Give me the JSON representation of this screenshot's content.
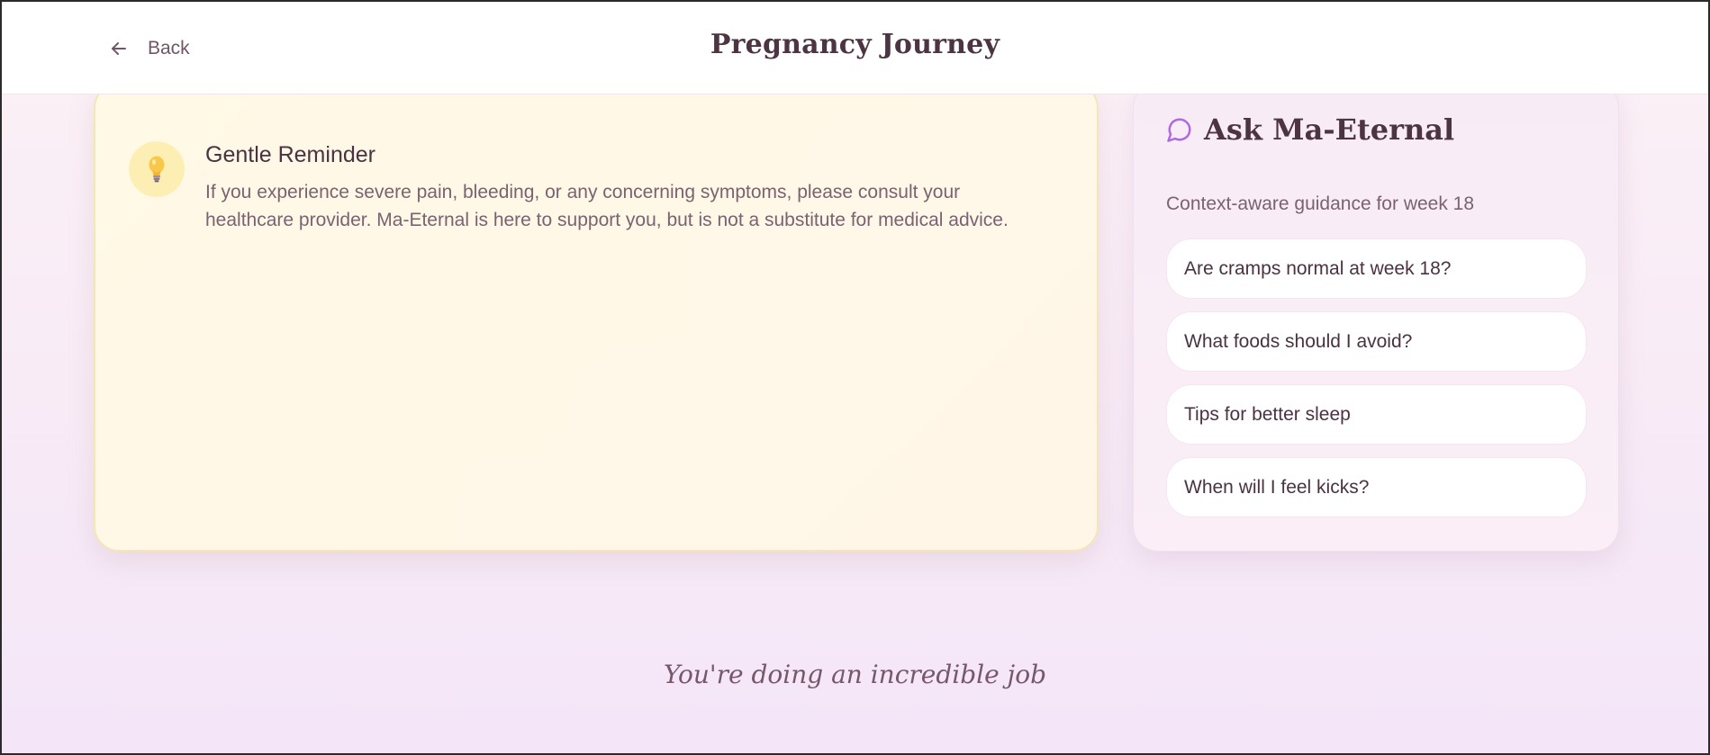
{
  "header": {
    "back_label": "Back",
    "title": "Pregnancy Journey",
    "back_icon": "arrow-left-icon"
  },
  "reminder": {
    "icon": "lightbulb-icon",
    "title": "Gentle Reminder",
    "text": "If you experience severe pain, bleeding, or any concerning symptoms, please consult your healthcare provider. Ma-Eternal is here to support you, but is not a substitute for medical advice.",
    "background_color": "#fff9e6"
  },
  "ask": {
    "icon": "chat-bubble-icon",
    "title": "Ask Ma-Eternal",
    "subtitle": "Context-aware guidance for week 18",
    "questions": [
      "Are cramps normal at week 18?",
      "What foods should I avoid?",
      "Tips for better sleep",
      "When will I feel kicks?"
    ],
    "accent_color": "#b06adf"
  },
  "footer": {
    "message": "You're doing an incredible job"
  }
}
